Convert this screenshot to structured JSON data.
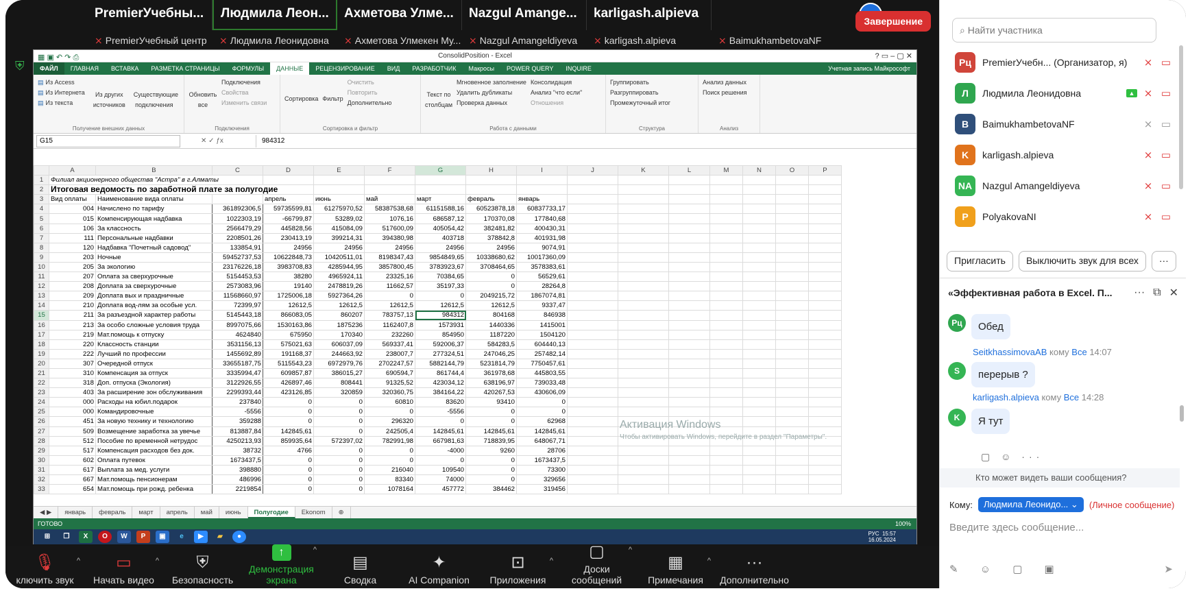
{
  "video_tiles": [
    "PremierУчебны...",
    "Людмила Леон...",
    "Ахметова Улме...",
    "Nazgul Amange...",
    "karligash.alpieva"
  ],
  "name_labels": [
    "PremierУчебный центр",
    "Людмила Леонидовна",
    "Ахметова Улмекен Му...",
    "Nazgul Amangeldiyeva",
    "karligash.alpieva",
    "BaimukhambetovaNF"
  ],
  "excel": {
    "title": "ConsolidPosition - Excel",
    "tabs": [
      "ФАЙЛ",
      "ГЛАВНАЯ",
      "ВСТАВКА",
      "РАЗМЕТКА СТРАНИЦЫ",
      "ФОРМУЛЫ",
      "ДАННЫЕ",
      "РЕЦЕНЗИРОВАНИЕ",
      "ВИД",
      "РАЗРАБОТЧИК",
      "Макросы",
      "POWER QUERY",
      "INQUIRE"
    ],
    "account": "Учетная запись Майкрософт",
    "ribbon": {
      "g1": [
        "Из Access",
        "Из Интернета",
        "Из текста",
        "Из других источников",
        "Существующие подключения"
      ],
      "g1_label": "Получение внешних данных",
      "g2": [
        "Обновить все",
        "Подключения",
        "Свойства",
        "Изменить связи"
      ],
      "g2_label": "Подключения",
      "g3": [
        "Сортировка",
        "Фильтр",
        "Очистить",
        "Повторить",
        "Дополнительно"
      ],
      "g3_label": "Сортировка и фильтр",
      "g4": [
        "Текст по столбцам",
        "Мгновенное заполнение",
        "Удалить дубликаты",
        "Проверка данных",
        "Консолидация",
        "Анализ \"что если\"",
        "Отношения"
      ],
      "g4_label": "Работа с данными",
      "g5": [
        "Группировать",
        "Разгруппировать",
        "Промежуточный итог"
      ],
      "g5_label": "Структура",
      "g6": [
        "Анализ данных",
        "Поиск решения"
      ],
      "g6_label": "Анализ"
    },
    "namebox": "G15",
    "formula": "984312",
    "cols": [
      "A",
      "B",
      "C",
      "D",
      "E",
      "F",
      "G",
      "H",
      "I",
      "J",
      "K",
      "L",
      "M",
      "N",
      "O",
      "P"
    ],
    "row1": "Филиал акционерного общества \"Астра\" в г.Алматы",
    "row2": "Итоговая ведомость по заработной плате за полугодие",
    "headers": [
      "Вид оплаты",
      "Наименование вида оплаты",
      "",
      "апрель",
      "июнь",
      "май",
      "март",
      "февраль",
      "январь"
    ],
    "rows": [
      [
        "004",
        "Начислено по тарифу",
        "361892306,5",
        "59735599,81",
        "61275970,52",
        "58387538,68",
        "61151588,16",
        "60523878,18",
        "60837733,17"
      ],
      [
        "015",
        "Компенсирующая надбавка",
        "1022303,19",
        "-66799,87",
        "53289,02",
        "1076,16",
        "686587,12",
        "170370,08",
        "177840,68"
      ],
      [
        "106",
        "За классность",
        "2566479,29",
        "445828,56",
        "415084,09",
        "517600,09",
        "405054,42",
        "382481,82",
        "400430,31"
      ],
      [
        "111",
        "Персональные надбавки",
        "2208501,26",
        "230413,19",
        "399214,31",
        "394380,98",
        "403718",
        "378842,8",
        "401931,98"
      ],
      [
        "120",
        "Надбавка \"Почетный садовод\"",
        "133854,91",
        "24956",
        "24956",
        "24956",
        "24956",
        "24956",
        "9074,91"
      ],
      [
        "203",
        "Ночные",
        "59452737,53",
        "10622848,73",
        "10420511,01",
        "8198347,43",
        "9854849,65",
        "10338680,62",
        "10017360,09"
      ],
      [
        "205",
        "За экологию",
        "23176226,18",
        "3983708,83",
        "4285944,95",
        "3857800,45",
        "3783923,67",
        "3708464,65",
        "3578383,61"
      ],
      [
        "207",
        "Оплата за сверхурочные",
        "5154453,53",
        "38280",
        "4965924,11",
        "23325,16",
        "70384,65",
        "0",
        "56529,61"
      ],
      [
        "208",
        "Доплата за сверхурочные",
        "2573083,96",
        "19140",
        "2478819,26",
        "11662,57",
        "35197,33",
        "0",
        "28264,8"
      ],
      [
        "209",
        "Доплата вых и праздничные",
        "11568660,97",
        "1725006,18",
        "5927364,26",
        "0",
        "0",
        "2049215,72",
        "1867074,81"
      ],
      [
        "210",
        "Доплата вод-лям за особые усл.",
        "72399,97",
        "12612,5",
        "12612,5",
        "12612,5",
        "12612,5",
        "12612,5",
        "9337,47"
      ],
      [
        "211",
        "За разъездной характер работы",
        "5145443,18",
        "866083,05",
        "860207",
        "783757,13",
        "984312",
        "804168",
        "846938"
      ],
      [
        "213",
        "За особо сложные условия труда",
        "8997075,66",
        "1530163,86",
        "1875236",
        "1162407,8",
        "1573931",
        "1440336",
        "1415001"
      ],
      [
        "219",
        "Мат.помощь к отпуску",
        "4624840",
        "675950",
        "170340",
        "232260",
        "854950",
        "1187220",
        "1504120"
      ],
      [
        "220",
        "Классность станции",
        "3531156,13",
        "575021,63",
        "606037,09",
        "569337,41",
        "592006,37",
        "584283,5",
        "604440,13"
      ],
      [
        "222",
        "Лучший по профессии",
        "1455692,89",
        "191168,37",
        "244663,92",
        "238007,7",
        "277324,51",
        "247046,25",
        "257482,14"
      ],
      [
        "307",
        "Очередной отпуск",
        "33655187,75",
        "5115543,23",
        "6972979,76",
        "2702247,57",
        "5882144,79",
        "5231814,79",
        "7750457,61"
      ],
      [
        "310",
        "Компенсация за отпуск",
        "3335994,47",
        "609857,87",
        "386015,27",
        "690594,7",
        "861744,4",
        "361978,68",
        "445803,55"
      ],
      [
        "318",
        "Доп. отпуска (Экология)",
        "3122926,55",
        "426897,46",
        "808441",
        "91325,52",
        "423034,12",
        "638196,97",
        "739033,48"
      ],
      [
        "403",
        "За расширение зон обслуживания",
        "2299393,44",
        "423126,85",
        "320859",
        "320360,75",
        "384164,22",
        "420267,53",
        "430606,09"
      ],
      [
        "000",
        "Расходы на юбил.подарок",
        "237840",
        "0",
        "0",
        "60810",
        "83620",
        "93410",
        "0"
      ],
      [
        "000",
        "Командировочные",
        "-5556",
        "0",
        "0",
        "0",
        "-5556",
        "0",
        "0"
      ],
      [
        "451",
        "За новую технику и технологию",
        "359288",
        "0",
        "0",
        "296320",
        "0",
        "0",
        "62968"
      ],
      [
        "509",
        "Возмещение заработка за увечье",
        "813887,84",
        "142845,61",
        "0",
        "242505,4",
        "142845,61",
        "142845,61",
        "142845,61"
      ],
      [
        "512",
        "Пособие по временной нетрудос",
        "4250213,93",
        "859935,64",
        "572397,02",
        "782991,98",
        "667981,63",
        "718839,95",
        "648067,71"
      ],
      [
        "517",
        "Компенсация расходов без док.",
        "38732",
        "4766",
        "0",
        "0",
        "-4000",
        "9260",
        "28706"
      ],
      [
        "602",
        "Оплата путевок",
        "1673437,5",
        "0",
        "0",
        "0",
        "0",
        "0",
        "1673437,5"
      ],
      [
        "617",
        "Выплата за мед. услуги",
        "398880",
        "0",
        "0",
        "216040",
        "109540",
        "0",
        "73300"
      ],
      [
        "667",
        "Мат.помощь пенсионерам",
        "486996",
        "0",
        "0",
        "83340",
        "74000",
        "0",
        "329656"
      ],
      [
        "654",
        "Мат.помощь при рожд. ребенка",
        "2219854",
        "0",
        "0",
        "1078164",
        "457772",
        "384462",
        "319456"
      ]
    ],
    "sheets": [
      "январь",
      "февраль",
      "март",
      "апрель",
      "май",
      "июнь",
      "Полугодие",
      "Ekonom"
    ],
    "status": "ГОТОВО",
    "zoom": "100%",
    "watermark_title": "Активация Windows",
    "watermark_text": "Чтобы активировать Windows, перейдите в раздел \"Параметры\".",
    "tray_lang": "РУС",
    "tray_time": "15:57",
    "tray_date": "16.05.2024"
  },
  "toolbar": [
    {
      "label": "ключить звук",
      "icon": "mic-off-icon"
    },
    {
      "label": "Начать видео",
      "icon": "video-off-icon"
    },
    {
      "label": "Безопасность",
      "icon": "shield-icon"
    },
    {
      "label": "Демонстрация экрана",
      "icon": "share-screen-icon"
    },
    {
      "label": "Сводка",
      "icon": "summary-icon"
    },
    {
      "label": "AI Companion",
      "icon": "sparkle-icon"
    },
    {
      "label": "Приложения",
      "icon": "apps-icon"
    },
    {
      "label": "Доски сообщений",
      "icon": "whiteboard-icon"
    },
    {
      "label": "Примечания",
      "icon": "notes-icon"
    },
    {
      "label": "Дополнительно",
      "icon": "more-icon"
    }
  ],
  "end_label": "Завершение",
  "panel": {
    "search_placeholder": "Найти участника",
    "participants": [
      {
        "initials": "Рц",
        "name": "PremierУчебн... (Организатор, я)",
        "color": "#d0453a"
      },
      {
        "initials": "Л",
        "name": "Людмила Леонидовна",
        "color": "#2fa64f"
      },
      {
        "initials": "B",
        "name": "BaimukhambetovaNF",
        "color": "#2f4f7a"
      },
      {
        "initials": "K",
        "name": "karligash.alpieva",
        "color": "#e0731c"
      },
      {
        "initials": "NA",
        "name": "Nazgul Amangeldiyeva",
        "color": "#35b554"
      },
      {
        "initials": "P",
        "name": "PolyakovaNI",
        "color": "#f0a01c"
      }
    ],
    "invite": "Пригласить",
    "mute_all": "Выключить звук для всех",
    "more": "···"
  },
  "chat": {
    "title": "«Эффективная работа в Excel. П...",
    "messages": [
      {
        "initials": "Рц",
        "color": "#2fa64f",
        "text": "Обед"
      },
      {
        "sender": "SeitkhassimovaAB",
        "to": "кому",
        "everyone": "Все",
        "time": "14:07",
        "initials": "S",
        "color": "#35b554",
        "text": "перерыв ?"
      },
      {
        "sender": "karligash.alpieva",
        "to": "кому",
        "everyone": "Все",
        "time": "14:28",
        "initials": "K",
        "color": "#35b554",
        "text": "Я тут"
      }
    ],
    "who_sees": "Кто может видеть ваши сообщения?",
    "to_label": "Кому:",
    "recipient": "Людмила Леонидо...",
    "private": "(Личное сообщение)",
    "placeholder": "Введите здесь сообщение..."
  }
}
